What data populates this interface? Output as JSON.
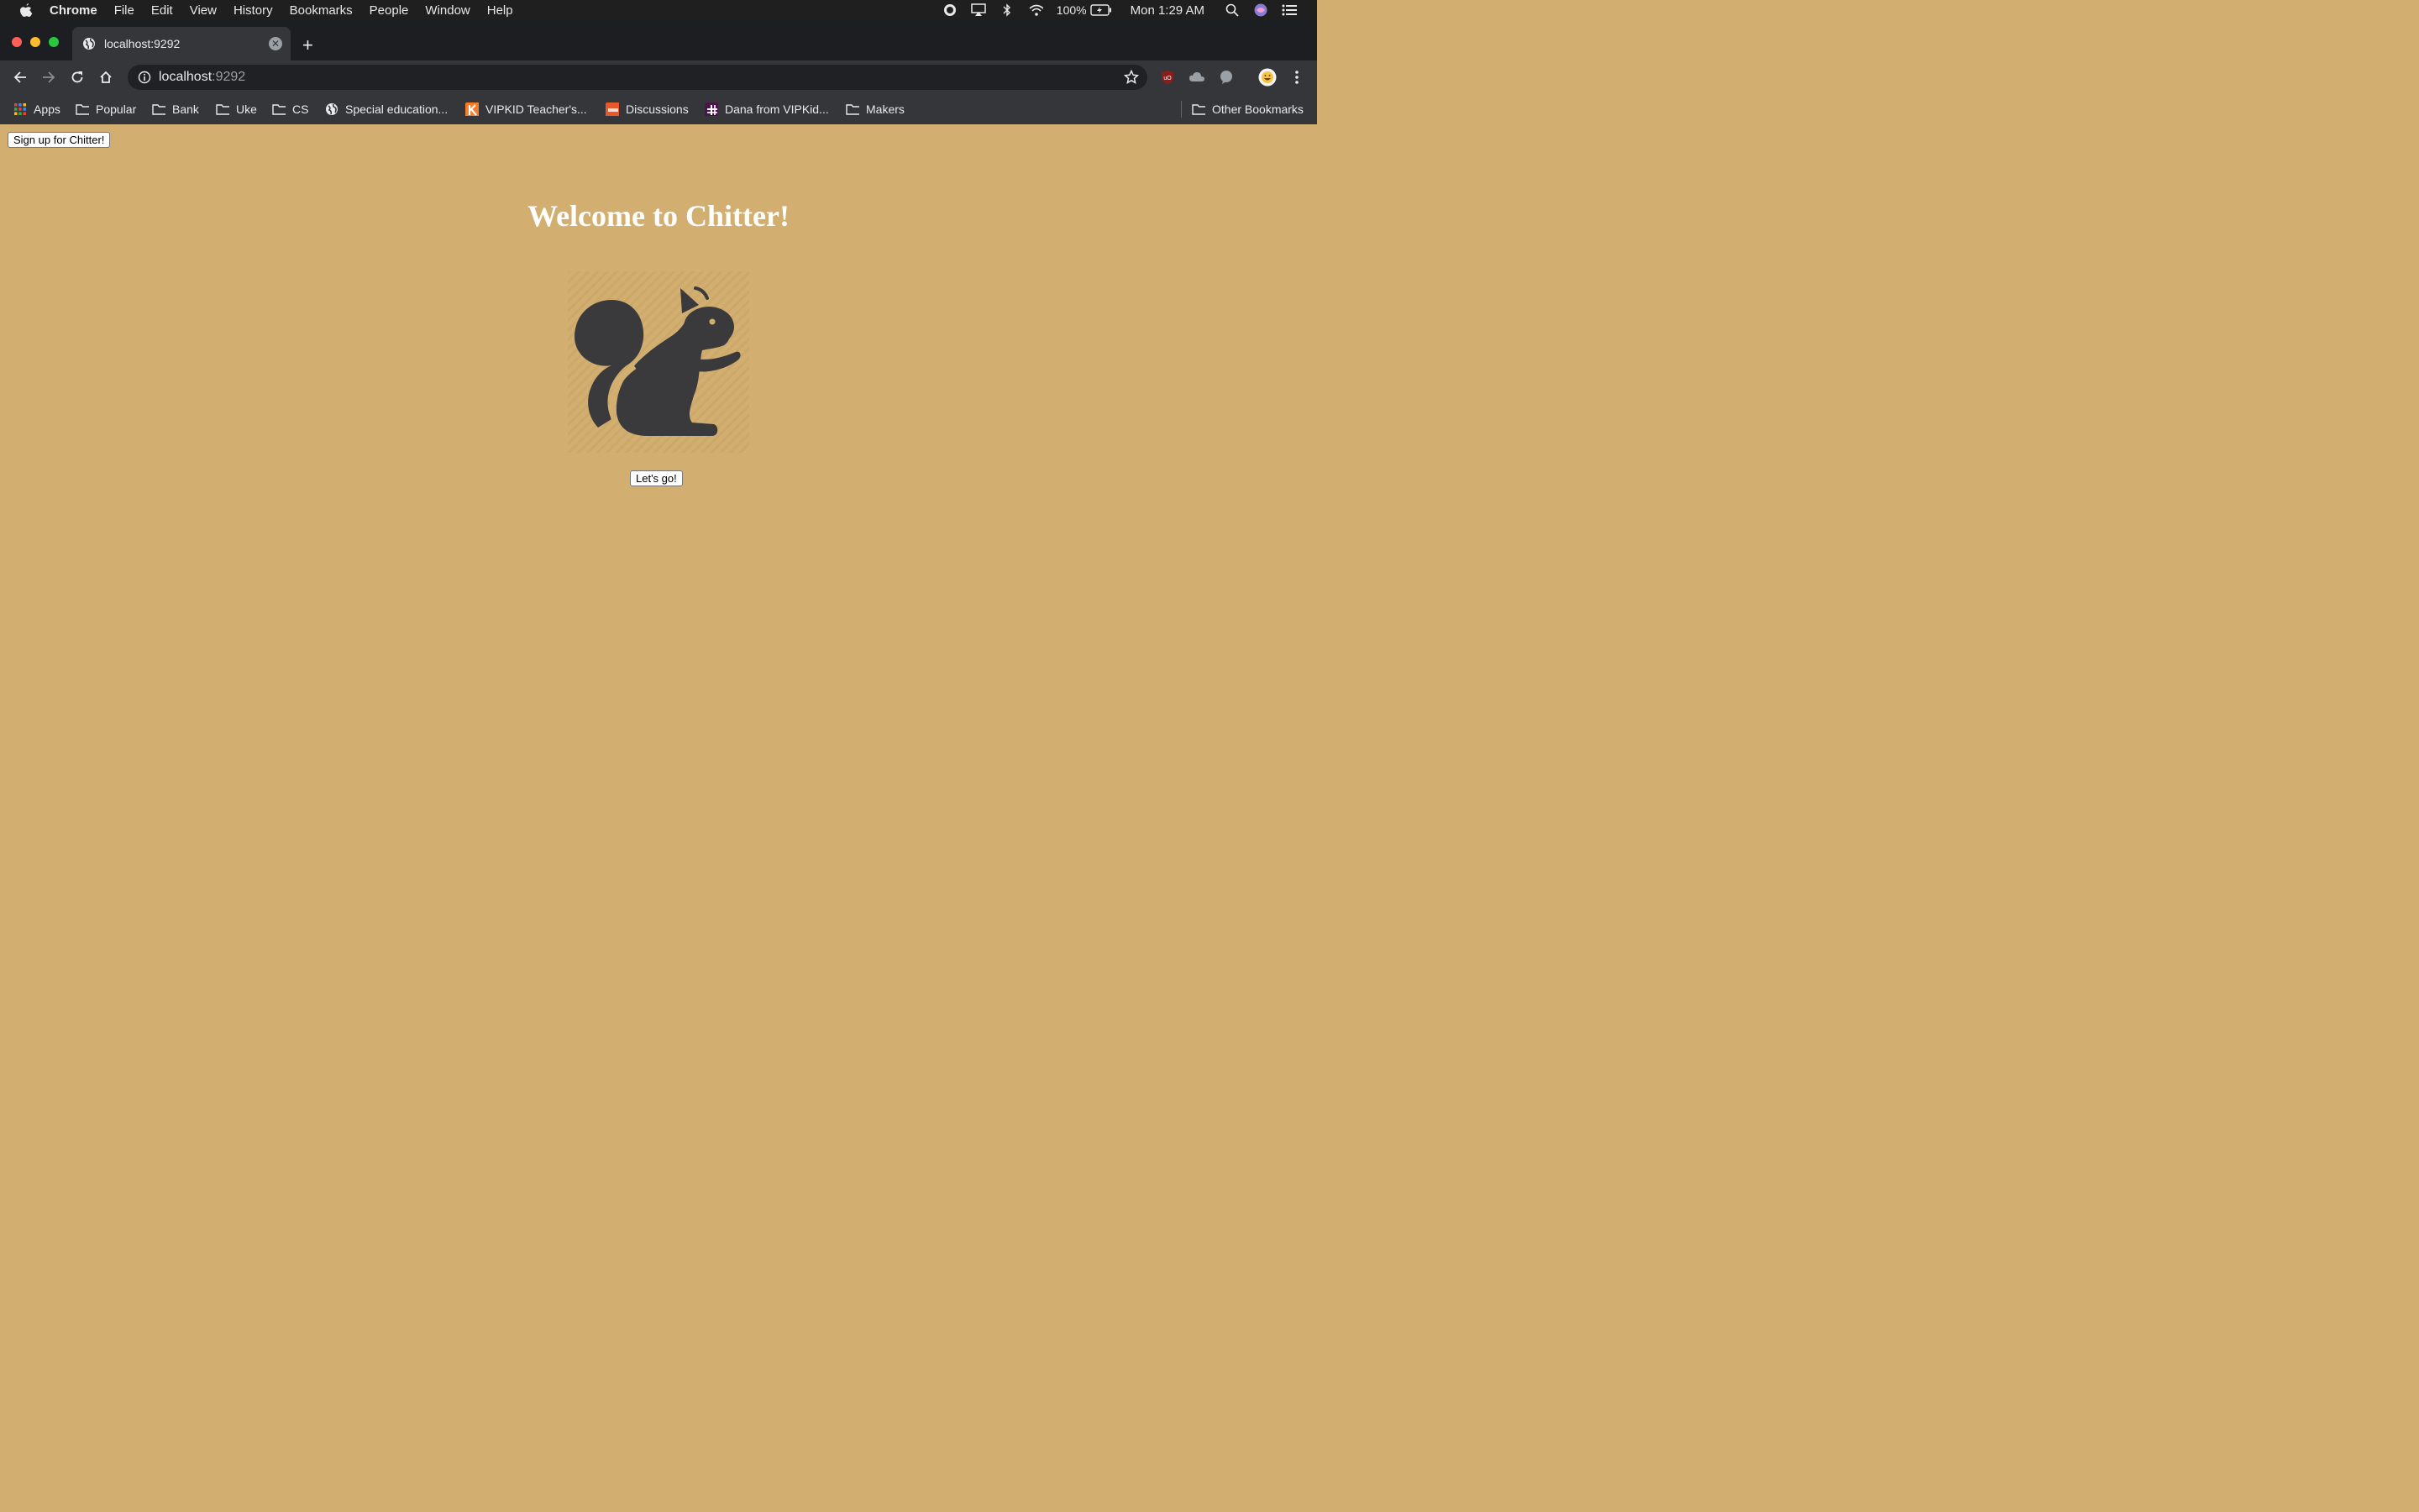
{
  "menubar": {
    "app_name": "Chrome",
    "menus": [
      "File",
      "Edit",
      "View",
      "History",
      "Bookmarks",
      "People",
      "Window",
      "Help"
    ],
    "battery": "100%",
    "clock": "Mon 1:29 AM"
  },
  "browser": {
    "tab_title": "localhost:9292",
    "url_host": "localhost",
    "url_port": ":9292",
    "bookmarks": [
      "Apps",
      "Popular",
      "Bank",
      "Uke",
      "CS",
      "Special education...",
      "VIPKID Teacher's...",
      "Discussions",
      "Dana from VIPKid...",
      "Makers"
    ],
    "other_bookmarks": "Other Bookmarks"
  },
  "page": {
    "signup_label": "Sign up for Chitter!",
    "heading": "Welcome to Chitter!",
    "cta_label": "Let's go!",
    "icon": "squirrel-icon",
    "background_color": "#d2af70"
  }
}
